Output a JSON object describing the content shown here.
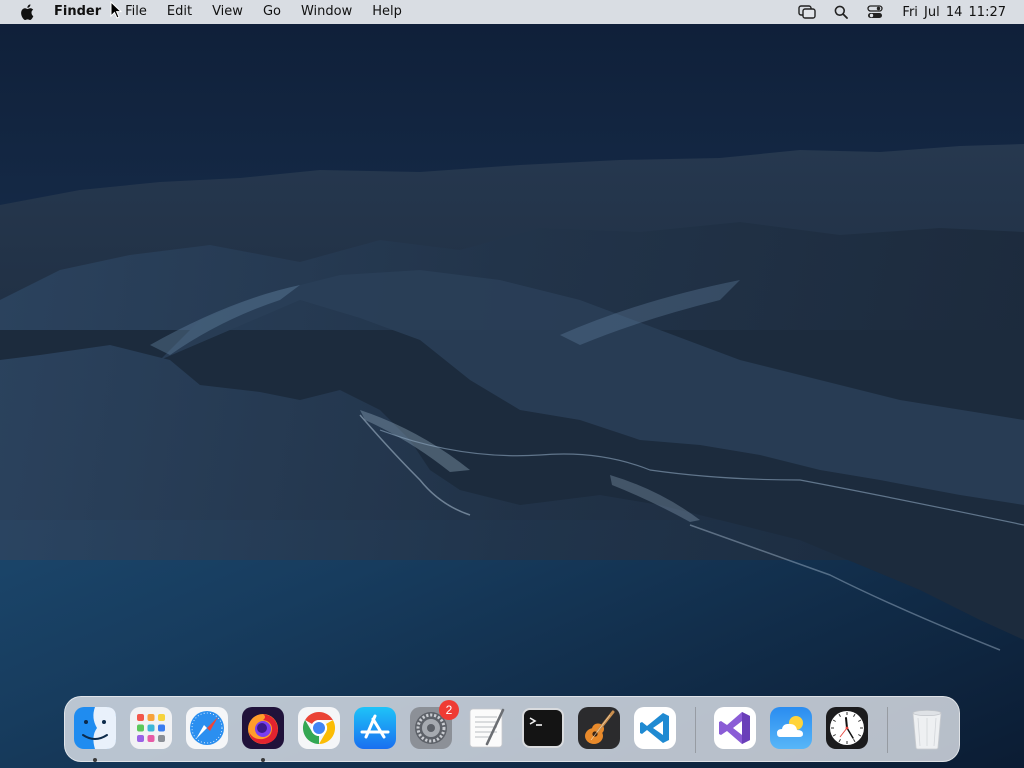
{
  "menubar": {
    "app_name": "Finder",
    "menus": [
      "File",
      "Edit",
      "View",
      "Go",
      "Window",
      "Help"
    ],
    "clock": "Fri Jul 14  11:27"
  },
  "dock": {
    "apps": [
      {
        "name": "finder-icon",
        "running": true
      },
      {
        "name": "launchpad-icon",
        "running": false
      },
      {
        "name": "safari-icon",
        "running": false
      },
      {
        "name": "firefox-icon",
        "running": true
      },
      {
        "name": "chrome-icon",
        "running": false
      },
      {
        "name": "app-store-icon",
        "running": false
      },
      {
        "name": "system-preferences-icon",
        "running": false,
        "badge": "2"
      },
      {
        "name": "textedit-icon",
        "running": false
      },
      {
        "name": "terminal-icon",
        "running": false
      },
      {
        "name": "garageband-icon",
        "running": false
      },
      {
        "name": "vscode-icon",
        "running": false
      },
      {
        "name": "visual-studio-icon",
        "running": false
      },
      {
        "name": "weather-icon",
        "running": false
      },
      {
        "name": "clock-icon",
        "running": false
      },
      {
        "name": "trash-icon",
        "running": false
      }
    ]
  },
  "colors": {
    "menubar_bg": "#e2e5ea",
    "dock_bg": "#e8ecf2",
    "badge_red": "#ef3b33",
    "wallpaper_sky": "#18304f",
    "wallpaper_sea": "#1d4a70"
  }
}
